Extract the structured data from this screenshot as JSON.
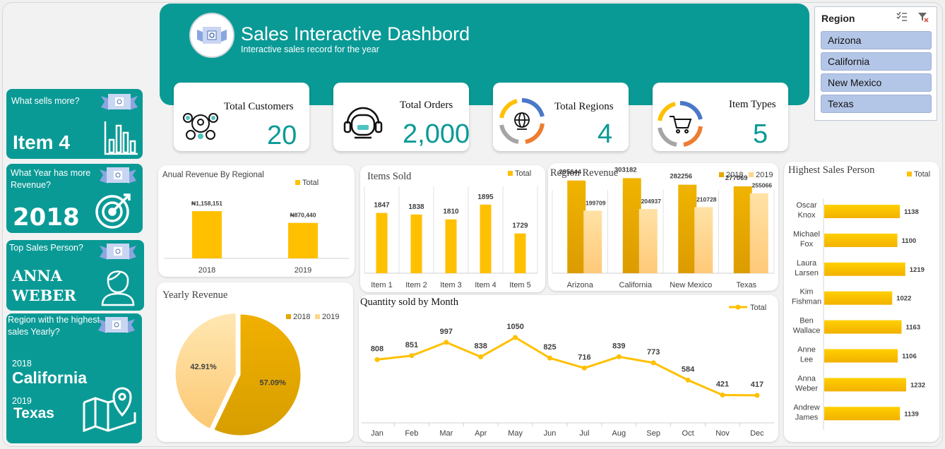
{
  "header": {
    "title": "Sales Interactive Dashbord",
    "subtitle": "Interactive sales record for the year"
  },
  "kpis": [
    {
      "label": "Total Customers",
      "value": "20",
      "icon": "customers-network-icon"
    },
    {
      "label": "Total Orders",
      "value": "2,000",
      "icon": "headset-agent-icon"
    },
    {
      "label": "Total Regions",
      "value": "4",
      "icon": "globe-location-icon"
    },
    {
      "label": "Item Types",
      "value": "5",
      "icon": "shopping-cart-icon"
    }
  ],
  "sidebar": {
    "what_sells": {
      "question": "What sells more?",
      "answer": "Item 4",
      "icon": "bar-chart-icon"
    },
    "year_revenue": {
      "question": "What Year has more Revenue?",
      "answer": "2018",
      "icon": "target-icon"
    },
    "top_sales": {
      "question": "Top Sales Person?",
      "answer_line1": "ANNA",
      "answer_line2": "WEBER",
      "icon": "person-icon"
    },
    "region_yearly": {
      "question": "Region with the highest sales Yearly?",
      "year1": "2018",
      "region1": "California",
      "year2": "2019",
      "region2": "Texas",
      "icon": "map-pin-icon"
    }
  },
  "slicer": {
    "title": "Region",
    "items": [
      "Arizona",
      "California",
      "New Mexico",
      "Texas"
    ],
    "selected": [
      "Arizona",
      "California",
      "New Mexico",
      "Texas"
    ]
  },
  "colors": {
    "teal": "#0a9a96",
    "gold": "#ffc000",
    "dark_gold": "#e6a800",
    "light_gold": "#ffd68a"
  },
  "chart_data": [
    {
      "id": "annual-revenue",
      "type": "bar",
      "title": "Anual Revenue By Regional",
      "categories": [
        "2018",
        "2019"
      ],
      "series": [
        {
          "name": "Total",
          "values": [
            1158151,
            870440
          ]
        }
      ],
      "data_labels": [
        "₦1,158,151",
        "₦870,440"
      ],
      "ylim": [
        0,
        1800000
      ],
      "legend": "top-right"
    },
    {
      "id": "items-sold",
      "type": "bar",
      "title": "Items Sold",
      "categories": [
        "Item 1",
        "Item 2",
        "Item 3",
        "Item 4",
        "Item 5"
      ],
      "series": [
        {
          "name": "Total",
          "values": [
            1847,
            1838,
            1810,
            1895,
            1729
          ]
        }
      ],
      "ylim": [
        1500,
        2000
      ],
      "legend": "top-right"
    },
    {
      "id": "region-revenue",
      "type": "bar",
      "title": "Region Revenue",
      "categories": [
        "Arizona",
        "California",
        "New Mexico",
        "Texas"
      ],
      "series": [
        {
          "name": "2018",
          "values": [
            295644,
            303182,
            282256,
            277069
          ]
        },
        {
          "name": "2019",
          "values": [
            199709,
            204937,
            210728,
            255066
          ]
        }
      ],
      "ylim": [
        0,
        350000
      ],
      "legend": "top-right"
    },
    {
      "id": "yearly-revenue",
      "type": "pie",
      "title": "Yearly Revenue",
      "categories": [
        "2018",
        "2019"
      ],
      "values": [
        57.09,
        42.91
      ],
      "data_labels": [
        "57.09%",
        "42.91%"
      ],
      "legend": "top-right"
    },
    {
      "id": "quantity-by-month",
      "type": "line",
      "title": "Quantity sold by Month",
      "categories": [
        "Jan",
        "Feb",
        "Mar",
        "Apr",
        "May",
        "Jun",
        "Jul",
        "Aug",
        "Sep",
        "Oct",
        "Nov",
        "Dec"
      ],
      "series": [
        {
          "name": "Total",
          "values": [
            808,
            851,
            997,
            838,
            1050,
            825,
            716,
            839,
            773,
            584,
            421,
            417
          ]
        }
      ],
      "legend": "top-right"
    },
    {
      "id": "highest-sales-person",
      "type": "bar",
      "orientation": "horizontal",
      "title": "Highest Sales Person",
      "categories": [
        "Oscar Knox",
        "Michael Fox",
        "Laura Larsen",
        "Kim Fishman",
        "Ben Wallace",
        "Anne Lee",
        "Anna Weber",
        "Andrew James"
      ],
      "series": [
        {
          "name": "Total",
          "values": [
            1138,
            1100,
            1219,
            1022,
            1163,
            1106,
            1232,
            1139
          ]
        }
      ],
      "xlim": [
        0,
        1300
      ],
      "legend": "top-right"
    }
  ]
}
